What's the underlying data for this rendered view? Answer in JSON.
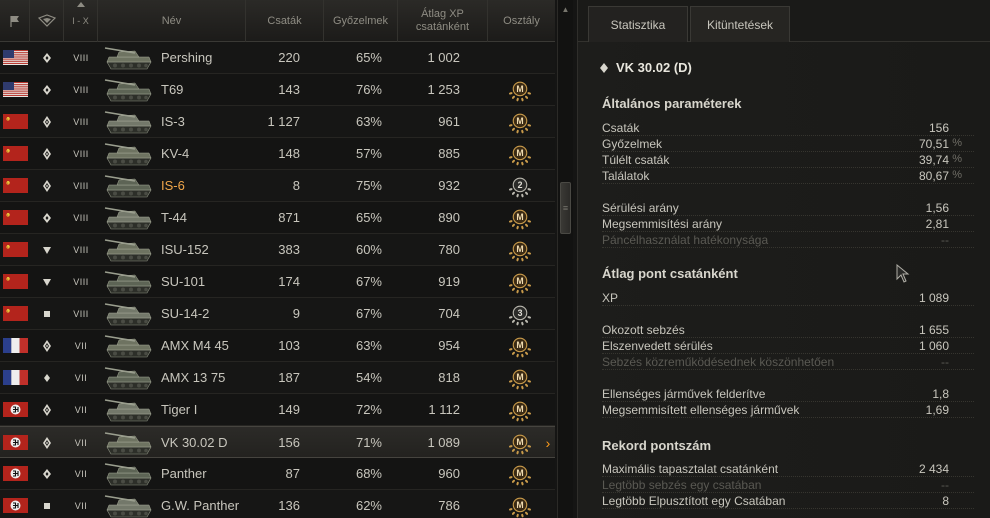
{
  "header": {
    "tier_label": "I - X",
    "name": "Név",
    "battles": "Csaták",
    "wins": "Győzelmek",
    "xp_line1": "Átlag XP",
    "xp_line2": "csatánként",
    "class": "Osztály"
  },
  "rows": [
    {
      "flag": "us",
      "type": "medium",
      "tier": "VIII",
      "name": "Pershing",
      "battles": "220",
      "wins": "65%",
      "xp": "1 002",
      "badge": "",
      "highlight": false,
      "selected": false
    },
    {
      "flag": "us",
      "type": "medium",
      "tier": "VIII",
      "name": "T69",
      "battles": "143",
      "wins": "76%",
      "xp": "1 253",
      "badge": "M",
      "highlight": false,
      "selected": false
    },
    {
      "flag": "ussr",
      "type": "heavy",
      "tier": "VIII",
      "name": "IS-3",
      "battles": "1 127",
      "wins": "63%",
      "xp": "961",
      "badge": "M",
      "highlight": false,
      "selected": false
    },
    {
      "flag": "ussr",
      "type": "heavy",
      "tier": "VIII",
      "name": "KV-4",
      "battles": "148",
      "wins": "57%",
      "xp": "885",
      "badge": "M",
      "highlight": false,
      "selected": false
    },
    {
      "flag": "ussr",
      "type": "heavy",
      "tier": "VIII",
      "name": "IS-6",
      "battles": "8",
      "wins": "75%",
      "xp": "932",
      "badge": "2",
      "highlight": true,
      "selected": false
    },
    {
      "flag": "ussr",
      "type": "medium",
      "tier": "VIII",
      "name": "T-44",
      "battles": "871",
      "wins": "65%",
      "xp": "890",
      "badge": "M",
      "highlight": false,
      "selected": false
    },
    {
      "flag": "ussr",
      "type": "td",
      "tier": "VIII",
      "name": "ISU-152",
      "battles": "383",
      "wins": "60%",
      "xp": "780",
      "badge": "M",
      "highlight": false,
      "selected": false
    },
    {
      "flag": "ussr",
      "type": "td",
      "tier": "VIII",
      "name": "SU-101",
      "battles": "174",
      "wins": "67%",
      "xp": "919",
      "badge": "M",
      "highlight": false,
      "selected": false
    },
    {
      "flag": "ussr",
      "type": "spg",
      "tier": "VIII",
      "name": "SU-14-2",
      "battles": "9",
      "wins": "67%",
      "xp": "704",
      "badge": "3",
      "highlight": false,
      "selected": false
    },
    {
      "flag": "fr",
      "type": "heavy",
      "tier": "VII",
      "name": "AMX M4 45",
      "battles": "103",
      "wins": "63%",
      "xp": "954",
      "badge": "M",
      "highlight": false,
      "selected": false
    },
    {
      "flag": "fr",
      "type": "light",
      "tier": "VII",
      "name": "AMX 13 75",
      "battles": "187",
      "wins": "54%",
      "xp": "818",
      "badge": "M",
      "highlight": false,
      "selected": false
    },
    {
      "flag": "de",
      "type": "heavy",
      "tier": "VII",
      "name": "Tiger I",
      "battles": "149",
      "wins": "72%",
      "xp": "1 112",
      "badge": "M",
      "highlight": false,
      "selected": false
    },
    {
      "flag": "de",
      "type": "heavy",
      "tier": "VII",
      "name": "VK 30.02 D",
      "battles": "156",
      "wins": "71%",
      "xp": "1 089",
      "badge": "M",
      "highlight": false,
      "selected": true
    },
    {
      "flag": "de",
      "type": "medium",
      "tier": "VII",
      "name": "Panther",
      "battles": "87",
      "wins": "68%",
      "xp": "960",
      "badge": "M",
      "highlight": false,
      "selected": false
    },
    {
      "flag": "de",
      "type": "spg",
      "tier": "VII",
      "name": "G.W. Panther",
      "battles": "136",
      "wins": "62%",
      "xp": "786",
      "badge": "M",
      "highlight": false,
      "selected": false
    }
  ],
  "panel": {
    "tabs": [
      "Statisztika",
      "Kitüntetések"
    ],
    "vehicle": "VK 30.02 (D)",
    "sections": {
      "general": "Általános paraméterek",
      "avg": "Átlag pont csatánként",
      "record": "Rekord pontszám"
    },
    "stats": {
      "battles": {
        "label": "Csaták",
        "value": "156",
        "unit": ""
      },
      "wins": {
        "label": "Győzelmek",
        "value": "70,51",
        "unit": "%"
      },
      "survived": {
        "label": "Túlélt csaták",
        "value": "39,74",
        "unit": "%"
      },
      "hits": {
        "label": "Találatok",
        "value": "80,67",
        "unit": "%"
      },
      "dmg_ratio": {
        "label": "Sérülési arány",
        "value": "1,56",
        "unit": ""
      },
      "kill_ratio": {
        "label": "Megsemmisítési arány",
        "value": "2,81",
        "unit": ""
      },
      "armor_eff": {
        "label": "Páncélhasználat hatékonysága",
        "value": "--",
        "unit": ""
      },
      "xp": {
        "label": "XP",
        "value": "1 089",
        "unit": ""
      },
      "dmg_dealt": {
        "label": "Okozott sebzés",
        "value": "1 655",
        "unit": ""
      },
      "dmg_taken": {
        "label": "Elszenvedett sérülés",
        "value": "1 060",
        "unit": ""
      },
      "assist": {
        "label": "Sebzés közreműködésednek köszönhetően",
        "value": "--",
        "unit": ""
      },
      "spotted": {
        "label": "Ellenséges járművek felderítve",
        "value": "1,8",
        "unit": ""
      },
      "destroyed": {
        "label": "Megsemmisített ellenséges járművek",
        "value": "1,69",
        "unit": ""
      },
      "max_xp": {
        "label": "Maximális tapasztalat csatánként",
        "value": "2 434",
        "unit": ""
      },
      "max_dmg": {
        "label": "Legtöbb sebzés egy csatában",
        "value": "--",
        "unit": ""
      },
      "max_kills": {
        "label": "Legtöbb Elpusztított egy Csatában",
        "value": "8",
        "unit": ""
      }
    }
  }
}
